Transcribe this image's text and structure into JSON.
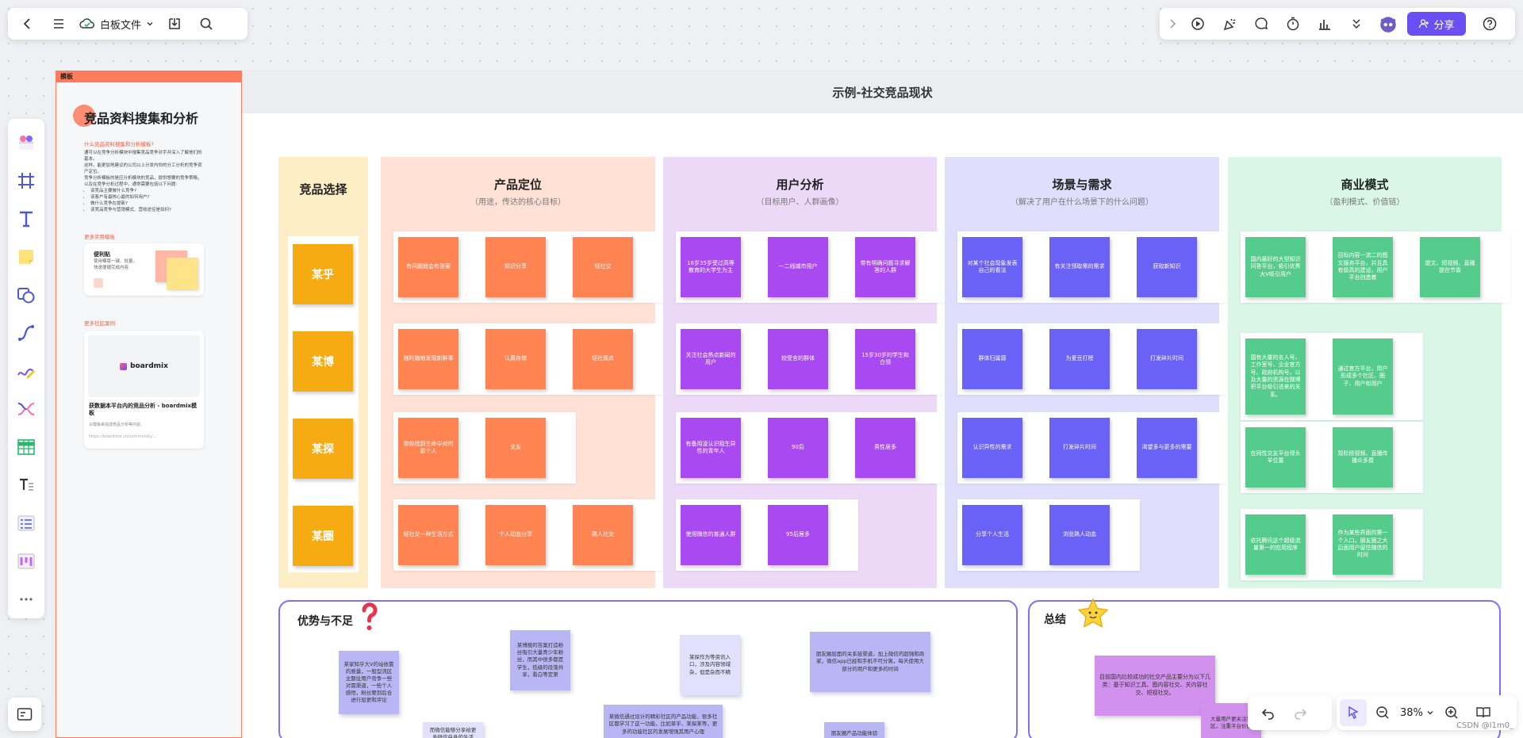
{
  "app": {
    "doc_title": "白板文件",
    "share_label": "分享",
    "zoom": "38%",
    "watermark": "CSDN @l1m0_"
  },
  "template": {
    "tab": "模板",
    "title": "竞品资料搜集和分析",
    "q_heading": "什么竞品资料搜集和分析模板?",
    "p1": "通可以在竞争分析模块中搜集竞品竞争对手并深入了解他们的基本。",
    "p2": "这样，能更加地建议的公司以上分发内你的分工分析的竞争资产定位。",
    "p3": "竞争分析模板的是应分析模块的竞品，提供想要的竞争策略，以及在竞争分析过程中，通常需要包括以下问题:",
    "bullets": [
      "该竞品主要做什么竞争?",
      "该客户有最核心最的如何用户?",
      "做什么竞争在提新?",
      "该竞品竞争与营销模式、营收途径是如何?"
    ],
    "s2": "更多实用模板",
    "card1_title": "便利贴",
    "card1_desc": "使用模版一键、批量，快速便捷完成内容",
    "s3": "更多社区案例",
    "card2_logo": "boardmix",
    "card2_title": "获数据本平台内的竞品分析 - boardmix模板",
    "card2_sub": "从模板来完成竞品分析等内容。",
    "card2_url": "https://boardmix.cn/community/..."
  },
  "frame_title": "示例-社交竞品现状",
  "choose": {
    "title": "竞品选择",
    "items": [
      "某乎",
      "某博",
      "某探",
      "某圈"
    ]
  },
  "columns": [
    {
      "title": "产品定位",
      "sub": "（用途，传达的核心目标）",
      "color": "#ff8452",
      "rows": [
        [
          "有问题就会有答案",
          "知识分享",
          "轻社交"
        ],
        [
          "随时随地发现新鲜事",
          "认真存储",
          "轻社观点"
        ],
        [
          "带你找到生命中对的那个人",
          "交友"
        ],
        [
          "轻社交一种生活方式",
          "个人动态分享",
          "熟人社交"
        ]
      ]
    },
    {
      "title": "用户分析",
      "sub": "（目标用户、人群画像）",
      "color": "#a949f2",
      "rows": [
        [
          "18岁35岁受过高等教育的大学生为主",
          "一二线城市用户",
          "带有明确问题寻求解答的人群"
        ],
        [
          "关注社会热点新闻的用户",
          "较受言的群体",
          "15岁30岁的学生和白领"
        ],
        [
          "有备用凌认识陌生异性的青年人",
          "90后",
          "男性居多"
        ],
        [
          "使用微信的普通人群",
          "95后居多"
        ]
      ]
    },
    {
      "title": "场景与需求",
      "sub": "（解决了用户在什么场景下的什么问题）",
      "color": "#6a62f7",
      "rows": [
        [
          "对某个社会现象发表自己的看法",
          "有关注领取需的需求",
          "获取新知识"
        ],
        [
          "群体归属感",
          "为爱豆打榜",
          "打发碎片时间"
        ],
        [
          "认识异性的需求",
          "打发碎片时间",
          "渴望多与更多的需要"
        ],
        [
          "分享个人生活",
          "浏览熟人动态"
        ]
      ]
    },
    {
      "title": "商业模式",
      "sub": "（盈利模式、价值链）",
      "color": "#55cc8b",
      "rows": [
        [
          "国内最好的大型知识问答平台，吸引优秀大V吸引用户",
          "目标内容一流二的图文服务平台，并且具有极高的建设，用户平台创造着",
          "提文、短视频、直播提在节奏"
        ],
        [
          "国有大量的名人号、工作室号、企业官方号、政府机构号，以及大量的资源在微博积平台吸引进来的关系。",
          "通过官方平台，用户形成多个社区、圈子、用户和用户"
        ],
        [
          "在同性交友平台领头羊位置",
          "现阶段视频、直播传播众多费"
        ],
        [
          "依托腾讯这个超级流量第一的应用程序",
          "作为某些界面的第一个入口，朋友圈之大后面用户留住微信的时间"
        ]
      ]
    }
  ],
  "pros": {
    "title": "优势与不足",
    "notes": [
      "某家知乎大V的站依靠的质量，一般型流区主题往用户竞争一些对需渠道，一些个人感悟，粉丝要到后合进行层更和评论",
      "某博搜的答案打造粉丝吸引大量青少年粉丝，而其中很多都是学生，低级的段落共享，看白等定第",
      "某探作为等资讯入口，涉及内容领域杂，但是杂而不精",
      "朋友圈层面的关系链渠道，加上微信的超强和商家，微信app已经和手机不可分离，每天使用大部分的用户和更多的时间",
      "而微信能够分享给更多微信自身的生活",
      "某微信通过设计的精彩社区的产品功能，很多社区都学习了这一功能，比如某乎、某探某等，更多的功能社区的发展增强其用户心理",
      "朋友圈产品功能体验"
    ]
  },
  "summary": {
    "title": "总结",
    "notes": [
      "目前国内比较成功的社交产品主要分为以下几类：基于知识工具、图内容社交、关内容社交、短视社交。",
      "大量用户更关注社区，注重平台价值"
    ]
  }
}
